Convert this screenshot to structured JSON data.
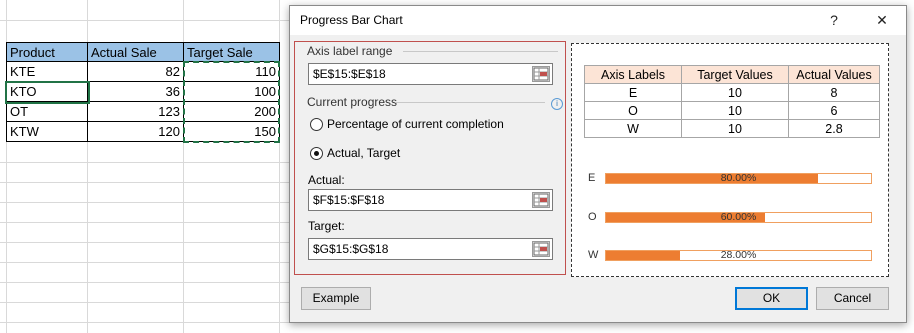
{
  "sheet": {
    "headers": [
      "Product",
      "Actual Sale",
      "Target Sale"
    ],
    "rows": [
      {
        "product": "KTE",
        "actual": "82",
        "target": "110"
      },
      {
        "product": "KTO",
        "actual": "36",
        "target": "100"
      },
      {
        "product": "OT",
        "actual": "123",
        "target": "200"
      },
      {
        "product": "KTW",
        "actual": "120",
        "target": "150"
      }
    ]
  },
  "dialog": {
    "title": "Progress Bar Chart",
    "help_label": "?",
    "close_label": "✕",
    "axis_group": "Axis label range",
    "axis_value": "$E$15:$E$18",
    "progress_group": "Current progress",
    "info_glyph": "i",
    "option_percentage": "Percentage of current completion",
    "option_actual": "Actual, Target",
    "selected_option": "Actual, Target",
    "actual_label": "Actual:",
    "actual_value": "$F$15:$F$18",
    "target_label": "Target:",
    "target_value": "$G$15:$G$18",
    "example_button": "Example",
    "ok_button": "OK",
    "cancel_button": "Cancel"
  },
  "preview_table": {
    "headers": [
      "Axis Labels",
      "Target Values",
      "Actual Values"
    ],
    "rows": [
      [
        "E",
        "10",
        "8"
      ],
      [
        "O",
        "10",
        "6"
      ],
      [
        "W",
        "10",
        "2.8"
      ]
    ]
  },
  "chart_data": {
    "type": "bar",
    "orientation": "horizontal",
    "categories": [
      "E",
      "O",
      "W"
    ],
    "values": [
      0.8,
      0.6,
      0.28
    ],
    "value_labels": [
      "80.00%",
      "60.00%",
      "28.00%"
    ],
    "xlim": [
      0,
      1
    ],
    "colors": {
      "fill": "#ed7d31",
      "border": "#f0a060"
    }
  },
  "colors": {
    "header_fill": "#9bc2e6",
    "selection": "#217346",
    "panel_border": "#c0504d",
    "accent": "#0078d7"
  }
}
